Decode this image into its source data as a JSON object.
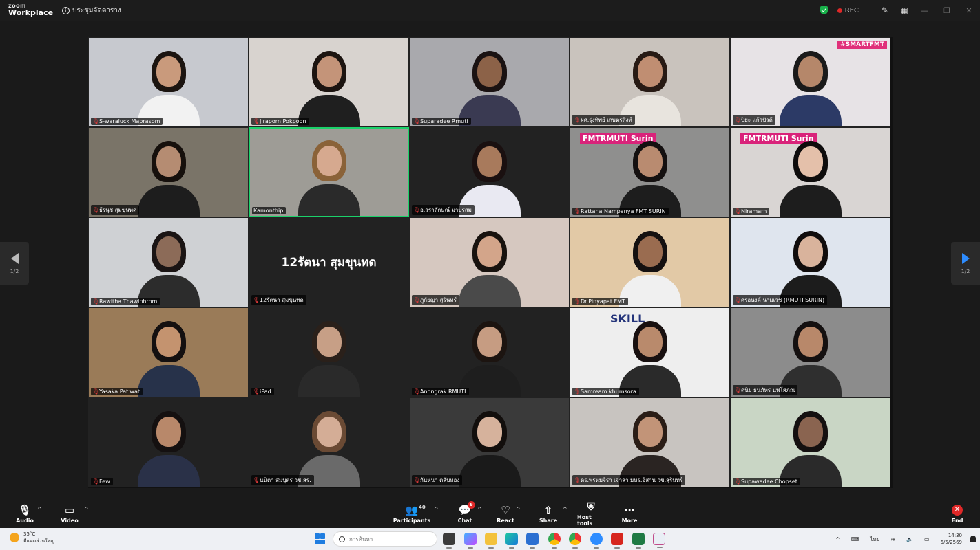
{
  "window": {
    "brand_top": "zoom",
    "brand_bottom": "Workplace",
    "meeting_title": "ประชุมจัดตาราง",
    "rec_label": "REC"
  },
  "gallery": {
    "page_indicator_left": "1/2",
    "page_indicator_right": "1/2",
    "tiles": [
      {
        "name": "S-waraluck Maprasom",
        "muted": true,
        "bg": "#c7c9cf",
        "skin": "#c99a7c",
        "hair": "#1b1410",
        "shirt": "#f2f2f2"
      },
      {
        "name": "Jiraporn Pokpoon",
        "muted": true,
        "bg": "#d8d3cf",
        "skin": "#c49479",
        "hair": "#1c1410",
        "shirt": "#1f1f1f"
      },
      {
        "name": "Suparadee Rmuti",
        "muted": true,
        "bg": "#a9a9ad",
        "skin": "#8c6248",
        "hair": "#1a1212",
        "shirt": "#3a3a52"
      },
      {
        "name": "ผศ.รุ่งทิพย์ เกษตรสิงห์",
        "muted": true,
        "bg": "#c9c3bd",
        "skin": "#c08e72",
        "hair": "#271a14",
        "shirt": "#e8e4de"
      },
      {
        "name": "ปิยะ แก้วปัวดี",
        "muted": true,
        "bg": "#e7e3e6",
        "skin": "#b5876a",
        "hair": "#1a1a1a",
        "shirt": "#2c3a66",
        "banner": "#SMARTFMT"
      },
      {
        "name": "ธีรนุช สุมขุนทด",
        "muted": true,
        "bg": "#7a7468",
        "skin": "#b58c72",
        "hair": "#16100c",
        "shirt": "#1d1d1d"
      },
      {
        "name": "Kamonthip",
        "muted": false,
        "active": true,
        "bg": "#9e9c96",
        "skin": "#d6a98f",
        "hair": "#8a6238",
        "shirt": "#2a2a2a"
      },
      {
        "name": "อ.วราลักษณ์ มาปรสม",
        "muted": true,
        "bg": "#222222",
        "skin": "#a87a5c",
        "hair": "#1a1010",
        "shirt": "#e9e9f2"
      },
      {
        "name": "Rattana Nampanya FMT SURIN",
        "muted": true,
        "bg": "#8f8f8e",
        "skin": "#b98b70",
        "hair": "#141010",
        "shirt": "#1d1d1d",
        "banner": "FMTRMUTI Surin"
      },
      {
        "name": "Niramarn",
        "muted": true,
        "bg": "#d9d5d3",
        "skin": "#e4c0aa",
        "hair": "#0e0c0c",
        "shirt": "#1d1d1d",
        "banner": "FMTRMUTI Surin"
      },
      {
        "name": "Rawitha Thawiphrom",
        "muted": true,
        "bg": "#cfd1d4",
        "skin": "#8c6b58",
        "hair": "#1a1414",
        "shirt": "#2c2c2c"
      },
      {
        "name": "12รัตนา สุมขุนทด",
        "muted": true,
        "bg": "#222222",
        "avatar_text": "12รัตนา สุมขุนทด"
      },
      {
        "name": "ภูกัยญา สุรินทร์",
        "muted": true,
        "bg": "#d6c8c0",
        "skin": "#d3a58a",
        "hair": "#18120e",
        "shirt": "#4a4a4a"
      },
      {
        "name": "Dr.Pinyapat FMT",
        "muted": true,
        "bg": "#e2c9a6",
        "skin": "#9a6c50",
        "hair": "#141010",
        "shirt": "#f0f0f0"
      },
      {
        "name": "ศรอนงค์ นามเวช (RMUTI SURIN)",
        "muted": true,
        "bg": "#dfe5ee",
        "skin": "#d9b39c",
        "hair": "#100c0c",
        "shirt": "#1c1c1c"
      },
      {
        "name": "Yasaka.Patiwat",
        "muted": true,
        "bg": "#9a7b58",
        "skin": "#c4936f",
        "hair": "#141010",
        "shirt": "#27324a"
      },
      {
        "name": "iPad",
        "muted": true,
        "bg": "#222222",
        "skin": "#c79f86",
        "hair": "#2a201a",
        "shirt": "#2a2a2a"
      },
      {
        "name": "Anongrak.RMUTI",
        "muted": true,
        "bg": "#222222",
        "skin": "#c69c82",
        "hair": "#1c1410",
        "shirt": "#1e1e1e"
      },
      {
        "name": "Samream khumsora",
        "muted": true,
        "bg": "#eeeeee",
        "skin": "#b98a6c",
        "hair": "#181010",
        "shirt": "#2a2a2a",
        "banner": "SKILL"
      },
      {
        "name": "ดนิย ธนภัทร นพโสภณ",
        "muted": true,
        "bg": "#8c8c8c",
        "skin": "#b8886a",
        "hair": "#141010",
        "shirt": "#2f2f2f"
      },
      {
        "name": "Few",
        "muted": true,
        "bg": "#222222",
        "skin": "#b8886a",
        "hair": "#141010",
        "shirt": "#2a3148"
      },
      {
        "name": "นนิดา สมบุตร วช.สร.",
        "muted": true,
        "bg": "#222222",
        "skin": "#d4ad96",
        "hair": "#6a4a34",
        "shirt": "#6a6a6a"
      },
      {
        "name": "กันหนา ตลับทอง",
        "muted": true,
        "bg": "#3a3a3a",
        "skin": "#d6b29c",
        "hair": "#120e0c",
        "shirt": "#1a1a1a"
      },
      {
        "name": "ดร.พรหมจิรา เจาลา มหร.อีสาน วข.สุรินทร์",
        "muted": true,
        "bg": "#c8c4c0",
        "skin": "#c29478",
        "hair": "#2a1d16",
        "shirt": "#2a2422"
      },
      {
        "name": "Supawadee Chopset",
        "muted": true,
        "bg": "#c9d6c5",
        "skin": "#8a6450",
        "hair": "#141010",
        "shirt": "#2a2a2a"
      }
    ]
  },
  "toolbar": {
    "audio": "Audio",
    "video": "Video",
    "participants": "Participants",
    "participants_count": "40",
    "chat": "Chat",
    "chat_badge": "9",
    "react": "React",
    "share": "Share",
    "host_tools": "Host tools",
    "more": "More",
    "end": "End"
  },
  "taskbar": {
    "temperature": "35°C",
    "weather_desc": "มีแดดส่วนใหญ่",
    "search_placeholder": "การค้นหา",
    "lang": "ไทย",
    "time": "14:30",
    "date": "6/5/2569"
  }
}
